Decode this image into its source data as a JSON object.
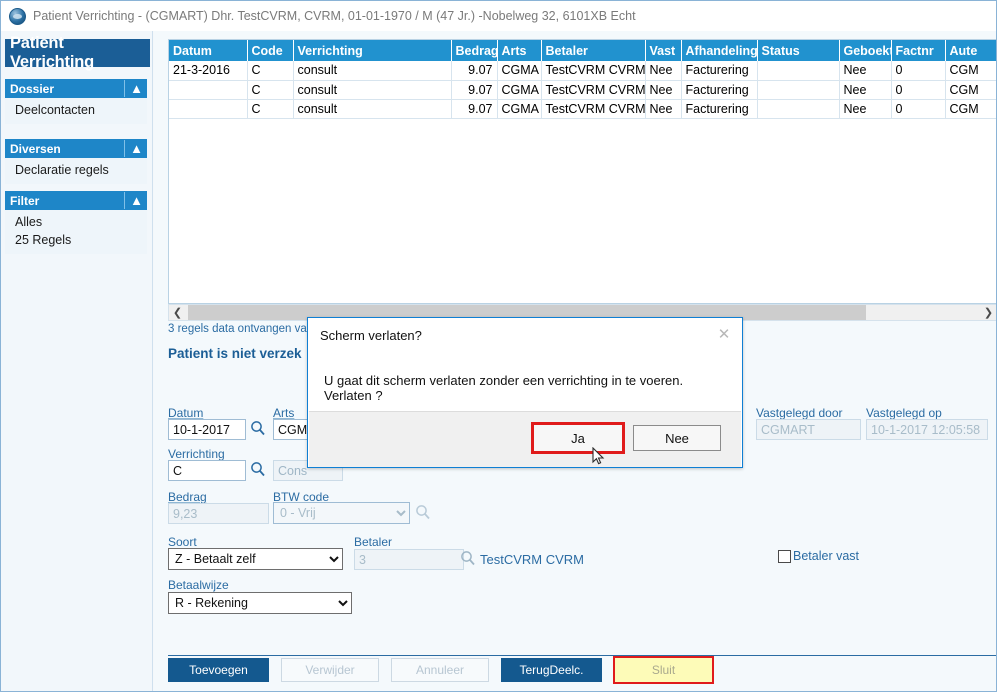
{
  "window": {
    "title": "Patient Verrichting - (CGMART) Dhr. TestCVRM, CVRM, 01-01-1970 / M (47 Jr.) -Nobelweg 32, 6101XB Echt",
    "app_icon": "app-globe-icon"
  },
  "sidebar": {
    "title": "Patient Verrichting",
    "panels": [
      {
        "head": "Dossier",
        "collapse_icon": "chevron-up-icon",
        "items": [
          "Deelcontacten"
        ]
      },
      {
        "head": "Diversen",
        "collapse_icon": "chevron-up-icon",
        "items": [
          "Declaratie regels"
        ]
      },
      {
        "head": "Filter",
        "collapse_icon": "chevron-up-icon",
        "items": [
          "Alles",
          "25 Regels"
        ]
      }
    ]
  },
  "grid": {
    "columns": [
      "Datum",
      "Code",
      "Verrichting",
      "Bedrag",
      "Arts",
      "Betaler",
      "Vast",
      "Afhandeling",
      "Status",
      "Geboekt",
      "Factnr",
      "Aute"
    ],
    "rows": [
      {
        "datum": "21-3-2016",
        "code": "C",
        "verrichting": "consult",
        "bedrag": "9.07",
        "arts": "CGMA",
        "betaler": "TestCVRM  CVRM",
        "vast": "Nee",
        "afhandeling": "Facturering",
        "status": "",
        "geboekt": "Nee",
        "factnr": "0",
        "auteur": "CGM"
      },
      {
        "datum": "",
        "code": "C",
        "verrichting": "consult",
        "bedrag": "9.07",
        "arts": "CGMA",
        "betaler": "TestCVRM  CVRM",
        "vast": "Nee",
        "afhandeling": "Facturering",
        "status": "",
        "geboekt": "Nee",
        "factnr": "0",
        "auteur": "CGM"
      },
      {
        "datum": "",
        "code": "C",
        "verrichting": "consult",
        "bedrag": "9.07",
        "arts": "CGMA",
        "betaler": "TestCVRM  CVRM",
        "vast": "Nee",
        "afhandeling": "Facturering",
        "status": "",
        "geboekt": "Nee",
        "factnr": "0",
        "auteur": "CGM"
      }
    ],
    "scrollbar": {
      "left_arrow": "chevron-left-icon",
      "right_arrow": "chevron-right-icon"
    }
  },
  "status_line": "3 regels data ontvangen va",
  "form": {
    "heading": "Patient is niet verzek",
    "datum": {
      "label": "Datum",
      "value": "10-1-2017",
      "search_icon": "magnifier-icon"
    },
    "arts": {
      "label": "Arts",
      "value": "CGM",
      "search_icon": "magnifier-icon"
    },
    "verrichting": {
      "label": "Verrichting",
      "value": "C",
      "desc_placeholder": "Cons",
      "search_icon": "magnifier-icon"
    },
    "bedrag": {
      "label": "Bedrag",
      "value": "9,23"
    },
    "btw": {
      "label": "BTW code",
      "value": "0 - Vrij",
      "options": [
        "0 - Vrij"
      ],
      "search_icon": "magnifier-icon"
    },
    "soort": {
      "label": "Soort",
      "value": "Z - Betaalt zelf",
      "options": [
        "Z - Betaalt zelf"
      ]
    },
    "betaler": {
      "label": "Betaler",
      "value": "3",
      "search_icon": "magnifier-icon",
      "name": "TestCVRM CVRM"
    },
    "betaalwijze": {
      "label": "Betaalwijze",
      "value": "R - Rekening",
      "options": [
        "R - Rekening"
      ]
    },
    "betaler_vast": {
      "label": "Betaler vast",
      "checked": false
    },
    "vastgelegd_door": {
      "label": "Vastgelegd door",
      "value": "CGMART"
    },
    "vastgelegd_op": {
      "label": "Vastgelegd op",
      "value": "10-1-2017 12:05:58"
    }
  },
  "buttons": {
    "toevoegen": "Toevoegen",
    "verwijder": "Verwijder",
    "annuleer": "Annuleer",
    "terugdeelc": "TerugDeelc.",
    "sluit": "Sluit"
  },
  "dialog": {
    "title": "Scherm verlaten?",
    "close_icon": "close-icon",
    "message": "U gaat dit scherm verlaten zonder een verrichting in te voeren. Verlaten ?",
    "confirm": "Ja",
    "cancel": "Nee"
  },
  "colors": {
    "accent_blue": "#1e86c8",
    "dark_blue": "#14598f",
    "header_blue": "#2192cf",
    "highlight_red": "#e01b1b",
    "highlight_yellow": "#fdfbb8"
  }
}
